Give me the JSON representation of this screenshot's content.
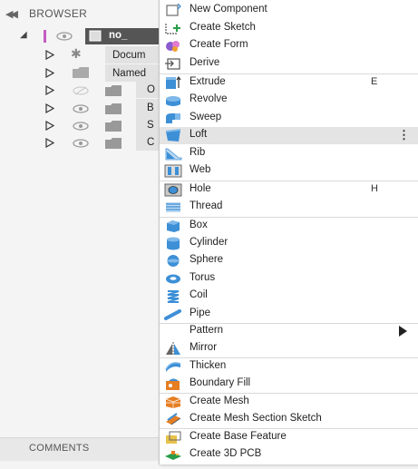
{
  "browser": {
    "title": "BROWSER",
    "root_name": "no_",
    "rows": [
      {
        "label": "Docum",
        "kind": "gear"
      },
      {
        "label": "Named",
        "kind": "folder"
      },
      {
        "label": "O",
        "kind": "hidden"
      },
      {
        "label": "B",
        "kind": "visible"
      },
      {
        "label": "S",
        "kind": "visible"
      },
      {
        "label": "C",
        "kind": "visible"
      }
    ]
  },
  "comments": {
    "label": "COMMENTS"
  },
  "menu": {
    "items": [
      {
        "label": "New Component",
        "icon": "new-component-icon"
      },
      {
        "label": "Create Sketch",
        "icon": "sketch-icon"
      },
      {
        "label": "Create Form",
        "icon": "form-icon"
      },
      {
        "label": "Derive",
        "icon": "derive-icon"
      },
      {
        "label": "Extrude",
        "icon": "extrude-icon",
        "shortcut": "E"
      },
      {
        "label": "Revolve",
        "icon": "revolve-icon"
      },
      {
        "label": "Sweep",
        "icon": "sweep-icon"
      },
      {
        "label": "Loft",
        "icon": "loft-icon",
        "more": "⋮"
      },
      {
        "label": "Rib",
        "icon": "rib-icon"
      },
      {
        "label": "Web",
        "icon": "web-icon"
      },
      {
        "label": "Hole",
        "icon": "hole-icon",
        "shortcut": "H"
      },
      {
        "label": "Thread",
        "icon": "thread-icon"
      },
      {
        "label": "Box",
        "icon": "box-icon"
      },
      {
        "label": "Cylinder",
        "icon": "cylinder-icon"
      },
      {
        "label": "Sphere",
        "icon": "sphere-icon"
      },
      {
        "label": "Torus",
        "icon": "torus-icon"
      },
      {
        "label": "Coil",
        "icon": "coil-icon"
      },
      {
        "label": "Pipe",
        "icon": "pipe-icon"
      },
      {
        "label": "Pattern",
        "icon": "",
        "submenu": true
      },
      {
        "label": "Mirror",
        "icon": "mirror-icon"
      },
      {
        "label": "Thicken",
        "icon": "thicken-icon"
      },
      {
        "label": "Boundary Fill",
        "icon": "boundary-fill-icon"
      },
      {
        "label": "Create Mesh",
        "icon": "mesh-icon"
      },
      {
        "label": "Create Mesh Section Sketch",
        "icon": "mesh-section-icon"
      },
      {
        "label": "Create Base Feature",
        "icon": "base-feature-icon"
      },
      {
        "label": "Create 3D PCB",
        "icon": "pcb-icon"
      }
    ]
  },
  "colors": {
    "accent_purple": "#c45cc4",
    "hover_row": "#e4e4e4",
    "tool_blue": "#3d8fd6"
  }
}
